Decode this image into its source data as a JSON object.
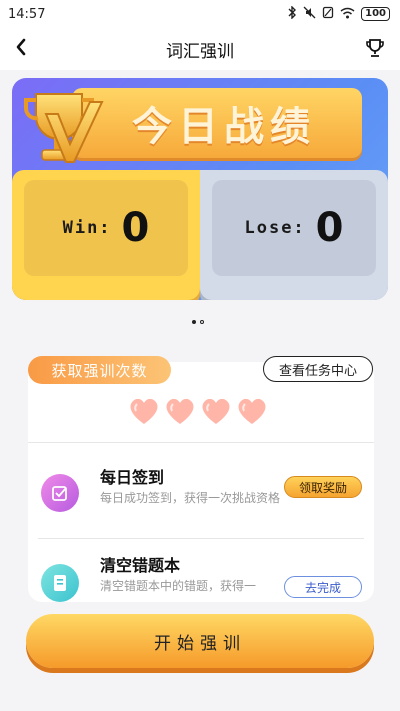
{
  "status_bar": {
    "time": "14:57",
    "battery": "100"
  },
  "nav": {
    "title": "词汇强训"
  },
  "hero": {
    "banner_title": "今日战绩",
    "win_label": "Win:",
    "win_value": "0",
    "lose_label": "Lose:",
    "lose_value": "0"
  },
  "panel": {
    "tag_label": "获取强训次数",
    "task_center_label": "查看任务中心",
    "hearts_count": 4,
    "tasks": [
      {
        "title": "每日签到",
        "desc": "每日成功签到，获得一次挑战资格",
        "action": "领取奖励"
      },
      {
        "title": "清空错题本",
        "desc": "清空错题本中的错题，获得一",
        "action": "去完成"
      }
    ]
  },
  "start_button": {
    "label": "开始强训"
  },
  "colors": {
    "accent": "#f7a534",
    "hero_bg": "#6b7ef5",
    "win": "#ffd44f",
    "lose": "#d4dbe8"
  }
}
